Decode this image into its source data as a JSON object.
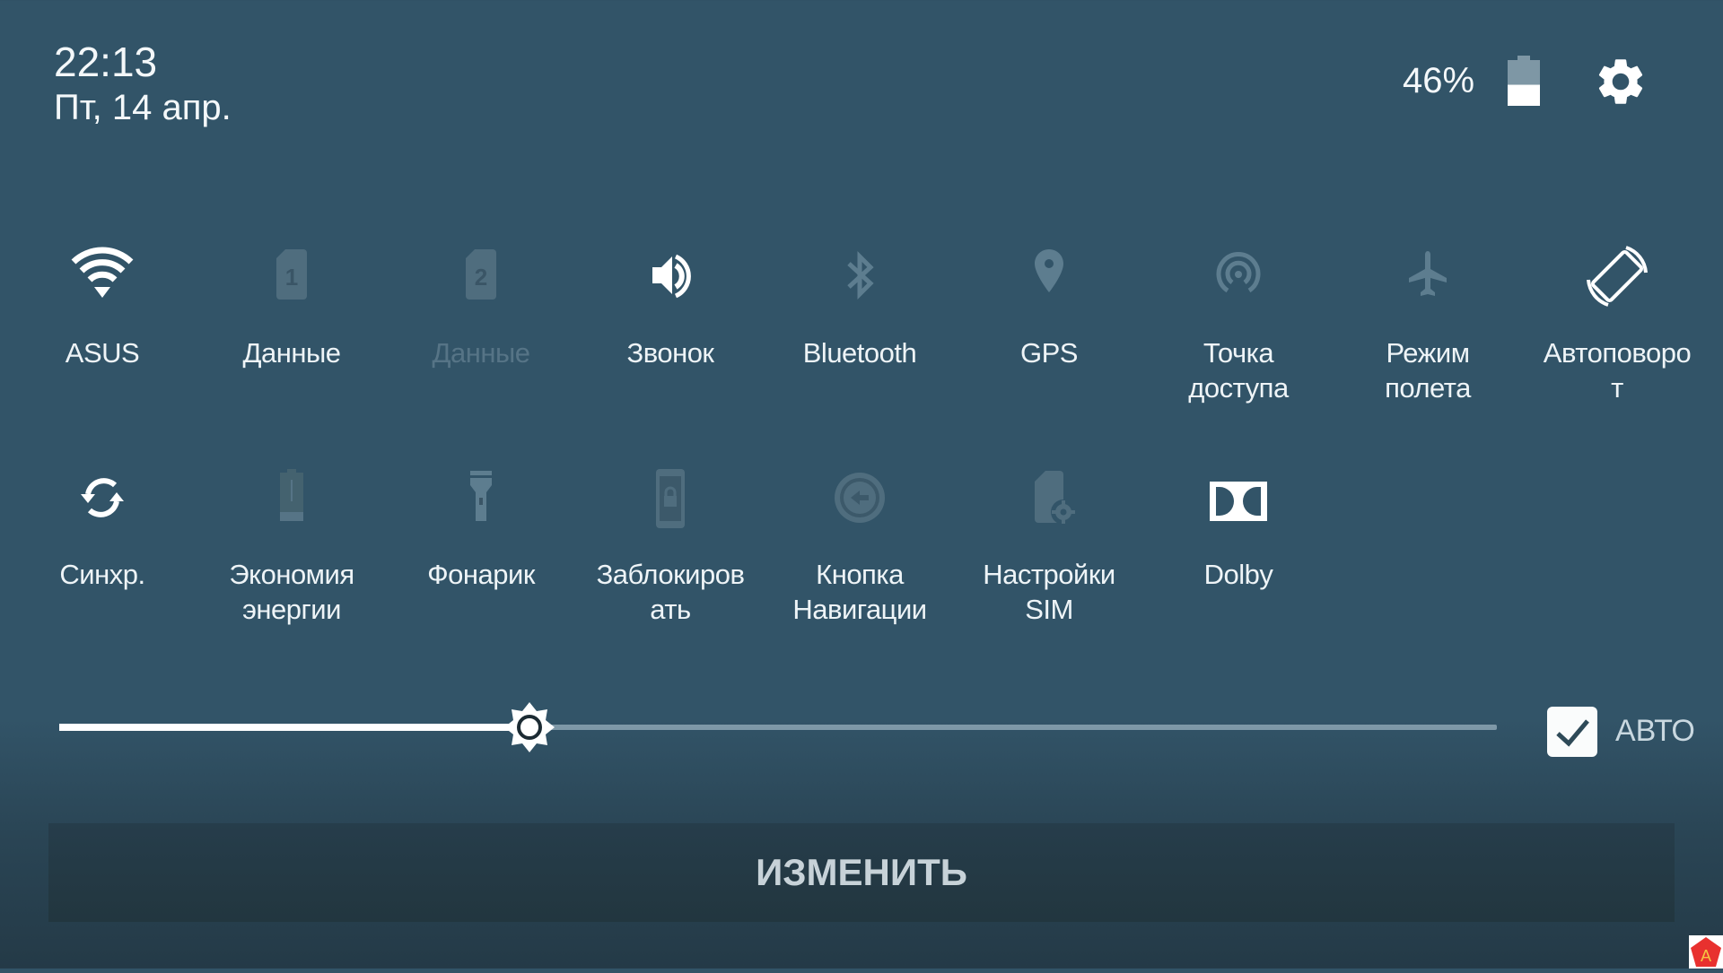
{
  "status": {
    "time": "22:13",
    "date": "Пт, 14 апр.",
    "battery_percent_label": "46%",
    "battery_level": 0.46,
    "battery_icon": "battery-icon",
    "settings_icon": "gear-icon"
  },
  "tiles": [
    {
      "label": "ASUS",
      "icon": "wifi-icon",
      "active": true
    },
    {
      "label": "Данные",
      "icon": "sim-1-icon",
      "active": false
    },
    {
      "label": "Данные",
      "icon": "sim-2-icon",
      "active": false,
      "disabled": true
    },
    {
      "label": "Звонок",
      "icon": "volume-icon",
      "active": true
    },
    {
      "label": "Bluetooth",
      "icon": "bluetooth-icon",
      "active": false
    },
    {
      "label": "GPS",
      "icon": "location-pin-icon",
      "active": false
    },
    {
      "label": "Точка\nдоступа",
      "label_lines": [
        "Точка",
        "доступа"
      ],
      "icon": "hotspot-icon",
      "active": false
    },
    {
      "label_lines": [
        "Режим",
        "полета"
      ],
      "icon": "airplane-icon",
      "active": false
    },
    {
      "label_lines": [
        "Автоповоро",
        "т"
      ],
      "icon": "auto-rotate-icon",
      "active": true
    },
    {
      "label_lines": [
        "Синхр."
      ],
      "icon": "sync-icon",
      "active": true
    },
    {
      "label_lines": [
        "Экономия",
        "энергии"
      ],
      "icon": "power-saver-icon",
      "active": false
    },
    {
      "label_lines": [
        "Фонарик"
      ],
      "icon": "flashlight-icon",
      "active": false
    },
    {
      "label_lines": [
        "Заблокиров",
        "ать"
      ],
      "icon": "lock-screen-icon",
      "active": false
    },
    {
      "label_lines": [
        "Кнопка",
        "Навигации"
      ],
      "icon": "nav-button-icon",
      "active": false
    },
    {
      "label_lines": [
        "Настройки",
        "SIM"
      ],
      "icon": "sim-settings-icon",
      "active": false
    },
    {
      "label_lines": [
        "Dolby"
      ],
      "icon": "dolby-icon",
      "active": true
    }
  ],
  "brightness": {
    "level": 0.327,
    "auto_checked": true,
    "auto_label": "АВТО"
  },
  "edit_button": {
    "label": "ИЗМЕНИТЬ"
  },
  "colors": {
    "background": "#325468",
    "active_icon": "#ffffff",
    "inactive_icon": "#5d7d8f",
    "badge": "#e8312f"
  }
}
